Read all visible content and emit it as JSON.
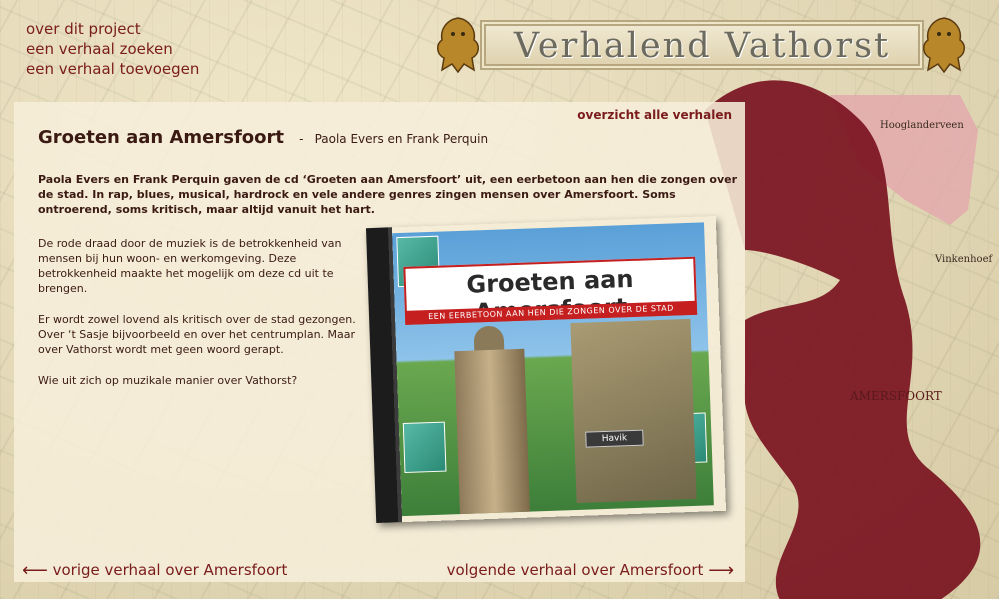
{
  "nav": {
    "about": "over dit project",
    "search": "een verhaal zoeken",
    "add": "een verhaal toevoegen"
  },
  "logo": {
    "title": "Verhalend Vathorst"
  },
  "panel": {
    "overview_link": "overzicht alle verhalen",
    "title": "Groeten aan Amersfoort",
    "separator": "-",
    "author": "Paola Evers en Frank Perquin",
    "intro": "Paola Evers en Frank Perquin gaven de cd ‘Groeten aan Amersfoort’ uit, een eerbetoon aan hen die zongen over de stad. In rap, blues, musical, hardrock en vele andere genres zingen mensen over Amersfoort. Soms ontroerend, soms kritisch, maar altijd vanuit het hart.",
    "paragraphs": [
      "De rode draad door de muziek is de betrokkenheid van mensen bij hun woon- en werkomgeving. Deze betrokkenheid maakte het mogelijk om deze cd uit te brengen.",
      "Er wordt zowel lovend als kritisch over de stad gezongen.  Over ‘t Sasje bijvoorbeeld en over het centrumplan. Maar over Vathorst wordt met geen woord gerapt.",
      "Wie uit zich op muzikale manier over Vathorst?"
    ]
  },
  "cd": {
    "title": "Groeten aan Amersfoort",
    "subtitle": "EEN EERBETOON AAN HEN DIE ZONGEN OVER DE STAD",
    "sign": "Havik"
  },
  "pager": {
    "prev_arrow": "⟵",
    "prev_label": "vorige verhaal over Amersfoort",
    "next_label": "volgende verhaal over Amersfoort",
    "next_arrow": "⟶"
  },
  "map_labels": [
    "Hooglanderveen",
    "Vinkenhoef",
    "AMERSFOORT"
  ],
  "colors": {
    "accent": "#7a1c1c",
    "region": "#7a1220",
    "region_light": "#e3a9ad"
  }
}
